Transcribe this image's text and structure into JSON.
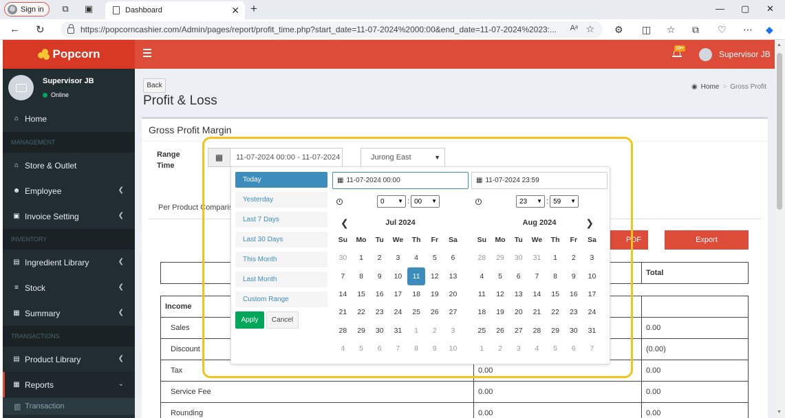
{
  "browser": {
    "sign_in": "Sign in",
    "tab_title": "Dashboard",
    "url": "https://popcorncashier.com/Admin/pages/report/profit_time.php?start_date=11-07-2024%2000:00&end_date=11-07-2024%2023:...",
    "reader_label": "A",
    "tab_close": "✕",
    "new_tab": "+",
    "win_min": "—",
    "win_max": "▢",
    "win_close": "✕"
  },
  "header": {
    "brand": "Popcorn",
    "notification_badge": "10+",
    "user_name": "Supervisor JB"
  },
  "sidebar": {
    "user_name": "Supervisor JB",
    "user_status": "Online",
    "sections": {
      "management": "MANAGEMENT",
      "inventory": "INVENTORY",
      "transactions": "TRANSACTIONS"
    },
    "items": {
      "home": "Home",
      "store": "Store & Outlet",
      "employee": "Employee",
      "invoice": "Invoice Setting",
      "ingredient": "Ingredient Library",
      "stock": "Stock",
      "summary": "Summary",
      "product": "Product Library",
      "reports": "Reports",
      "transaction": "Transaction"
    }
  },
  "content": {
    "back": "Back",
    "page_title": "Profit & Loss",
    "breadcrumb_home": "Home",
    "breadcrumb_current": "Gross Profit",
    "box_title": "Gross Profit Margin",
    "range_label_1": "Range",
    "range_label_2": "Time",
    "date_range": "11-07-2024 00:00 - 11-07-2024",
    "outlet": "Jurong East",
    "per_product": "Per Product Comparis",
    "pdf": "PDF",
    "export": "Export"
  },
  "table": {
    "total_header": "Total",
    "income": "Income",
    "rows": [
      {
        "label": "Sales",
        "mid": "",
        "total": "0.00"
      },
      {
        "label": "Discount",
        "mid": "",
        "total": "(0.00)"
      },
      {
        "label": "Tax",
        "mid": "0.00",
        "total": "0.00"
      },
      {
        "label": "Service Fee",
        "mid": "0.00",
        "total": "0.00"
      },
      {
        "label": "Rounding",
        "mid": "0.00",
        "total": "0.00"
      }
    ]
  },
  "picker": {
    "ranges": [
      "Today",
      "Yesterday",
      "Last 7 Days",
      "Last 30 Days",
      "This Month",
      "Last Month",
      "Custom Range"
    ],
    "active_range": "Today",
    "apply": "Apply",
    "cancel": "Cancel",
    "left": {
      "input": "11-07-2024 00:00",
      "hour": "0",
      "minute": "00",
      "month": "Jul 2024",
      "selected": 11,
      "days": [
        [
          "30",
          "1",
          "2",
          "3",
          "4",
          "5",
          "6"
        ],
        [
          "7",
          "8",
          "9",
          "10",
          "11",
          "12",
          "13"
        ],
        [
          "14",
          "15",
          "16",
          "17",
          "18",
          "19",
          "20"
        ],
        [
          "21",
          "22",
          "23",
          "24",
          "25",
          "26",
          "27"
        ],
        [
          "28",
          "29",
          "30",
          "31",
          "1",
          "2",
          "3"
        ],
        [
          "4",
          "5",
          "6",
          "7",
          "8",
          "9",
          "10"
        ]
      ],
      "off_first_row_count": 1,
      "off_from": [
        4,
        4
      ]
    },
    "right": {
      "input": "11-07-2024 23:59",
      "hour": "23",
      "minute": "59",
      "month": "Aug 2024",
      "days": [
        [
          "28",
          "29",
          "30",
          "31",
          "1",
          "2",
          "3"
        ],
        [
          "4",
          "5",
          "6",
          "7",
          "8",
          "9",
          "10"
        ],
        [
          "11",
          "12",
          "13",
          "14",
          "15",
          "16",
          "17"
        ],
        [
          "18",
          "19",
          "20",
          "21",
          "22",
          "23",
          "24"
        ],
        [
          "25",
          "26",
          "27",
          "28",
          "29",
          "30",
          "31"
        ],
        [
          "1",
          "2",
          "3",
          "4",
          "5",
          "6",
          "7"
        ]
      ]
    },
    "weekdays": [
      "Su",
      "Mo",
      "Tu",
      "We",
      "Th",
      "Fr",
      "Sa"
    ],
    "prev": "❮",
    "next": "❯"
  }
}
